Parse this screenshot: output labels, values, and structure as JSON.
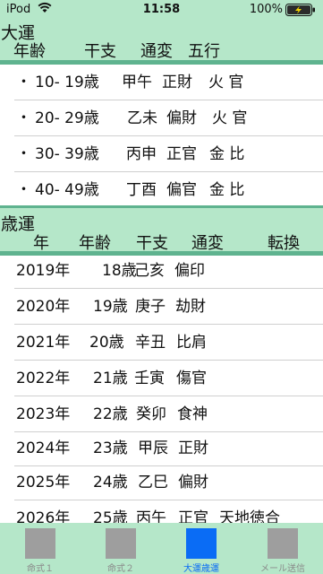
{
  "status": {
    "carrier": "iPod",
    "time": "11:58",
    "battery": "100%",
    "battery_level": 1.0
  },
  "taiun": {
    "title": "大運",
    "headers": [
      "年齢",
      "干支",
      "通変",
      "五行"
    ],
    "rows": [
      {
        "bullet": "・",
        "age": "10- 19歳",
        "kanshi": "甲午",
        "tsuhen": "正財",
        "gogyo": "火 官"
      },
      {
        "bullet": "・",
        "age": "20- 29歳",
        "kanshi": "乙未",
        "tsuhen": "偏財",
        "gogyo": "火 官"
      },
      {
        "bullet": "・",
        "age": "30- 39歳",
        "kanshi": "丙申",
        "tsuhen": "正官",
        "gogyo": "金 比"
      },
      {
        "bullet": "・",
        "age": "40- 49歳",
        "kanshi": "丁酉",
        "tsuhen": "偏官",
        "gogyo": "金 比"
      }
    ]
  },
  "saiun": {
    "title": "歳運",
    "headers": [
      "年",
      "年齢",
      "干支",
      "通変",
      "転換"
    ],
    "rows": [
      {
        "year": "2019年",
        "age": "18歳",
        "kanshi": "己亥",
        "tsuhen": "偏印",
        "tenkan": ""
      },
      {
        "year": "2020年",
        "age": "19歳",
        "kanshi": "庚子",
        "tsuhen": "劫財",
        "tenkan": ""
      },
      {
        "year": "2021年",
        "age": "20歳",
        "kanshi": "辛丑",
        "tsuhen": "比肩",
        "tenkan": ""
      },
      {
        "year": "2022年",
        "age": "21歳",
        "kanshi": "壬寅",
        "tsuhen": "傷官",
        "tenkan": ""
      },
      {
        "year": "2023年",
        "age": "22歳",
        "kanshi": "癸卯",
        "tsuhen": "食神",
        "tenkan": ""
      },
      {
        "year": "2024年",
        "age": "23歳",
        "kanshi": "甲辰",
        "tsuhen": "正財",
        "tenkan": ""
      },
      {
        "year": "2025年",
        "age": "24歳",
        "kanshi": "乙巳",
        "tsuhen": "偏財",
        "tenkan": ""
      },
      {
        "year": "2026年",
        "age": "25歳",
        "kanshi": "丙午",
        "tsuhen": "正官",
        "tenkan": "天地徳合"
      }
    ]
  },
  "tabs": [
    {
      "label": "命式１",
      "active": false
    },
    {
      "label": "命式２",
      "active": false
    },
    {
      "label": "大運歳運",
      "active": true
    },
    {
      "label": "メール送信",
      "active": false
    }
  ],
  "colors": {
    "header_bg": "#b5e7c9",
    "header_bar": "#5fb38f",
    "active_tab": "#0a6cf5",
    "inactive_tab": "#9e9e9e"
  }
}
